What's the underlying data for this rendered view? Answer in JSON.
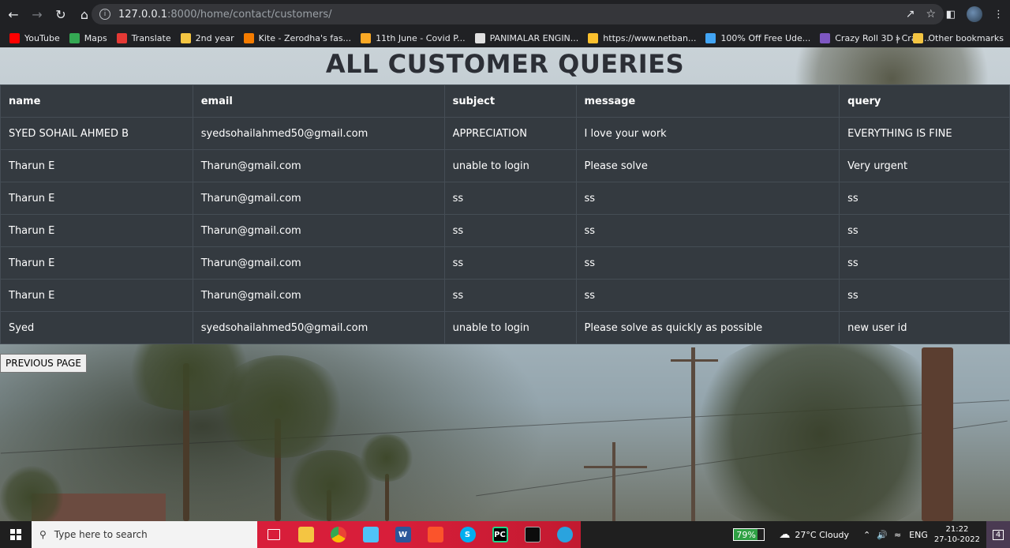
{
  "browser": {
    "url_host": "127.0.0.1",
    "url_path": ":8000/home/contact/customers/",
    "bookmarks": [
      {
        "label": "YouTube",
        "color": "#ff0000"
      },
      {
        "label": "Maps",
        "color": "#34a853"
      },
      {
        "label": "Translate",
        "color": "#e53935"
      },
      {
        "label": "2nd year",
        "color": "#f4c542"
      },
      {
        "label": "Kite - Zerodha's fas...",
        "color": "#f57c00"
      },
      {
        "label": "11th June - Covid P...",
        "color": "#f9a825"
      },
      {
        "label": "PANIMALAR ENGIN...",
        "color": "#e0e0e0"
      },
      {
        "label": "https://www.netban...",
        "color": "#fbc02d"
      },
      {
        "label": "100% Off Free Ude...",
        "color": "#42a5f5"
      },
      {
        "label": "Crazy Roll 3D | Craz...",
        "color": "#7e57c2"
      }
    ],
    "more_label": "»",
    "other_bookmarks": "Other bookmarks"
  },
  "page": {
    "title": "ALL CUSTOMER QUERIES",
    "columns": [
      "name",
      "email",
      "subject",
      "message",
      "query"
    ],
    "rows": [
      [
        "SYED SOHAIL AHMED B",
        "syedsohailahmed50@gmail.com",
        "APPRECIATION",
        "I love your work",
        "EVERYTHING IS FINE"
      ],
      [
        "Tharun E",
        "Tharun@gmail.com",
        "unable to login",
        "Please solve",
        "Very urgent"
      ],
      [
        "Tharun E",
        "Tharun@gmail.com",
        "ss",
        "ss",
        "ss"
      ],
      [
        "Tharun E",
        "Tharun@gmail.com",
        "ss",
        "ss",
        "ss"
      ],
      [
        "Tharun E",
        "Tharun@gmail.com",
        "ss",
        "ss",
        "ss"
      ],
      [
        "Tharun E",
        "Tharun@gmail.com",
        "ss",
        "ss",
        "ss"
      ],
      [
        "Syed",
        "syedsohailahmed50@gmail.com",
        "unable to login",
        "Please solve as quickly as possible",
        "new user id"
      ]
    ],
    "prev_button": "PREVIOUS PAGE"
  },
  "taskbar": {
    "search_placeholder": "Type here to search",
    "battery": "79%",
    "battery_level": 0.79,
    "weather": "27°C  Cloudy",
    "lang": "ENG",
    "time": "21:22",
    "date": "27-10-2022",
    "notif_count": "4"
  }
}
